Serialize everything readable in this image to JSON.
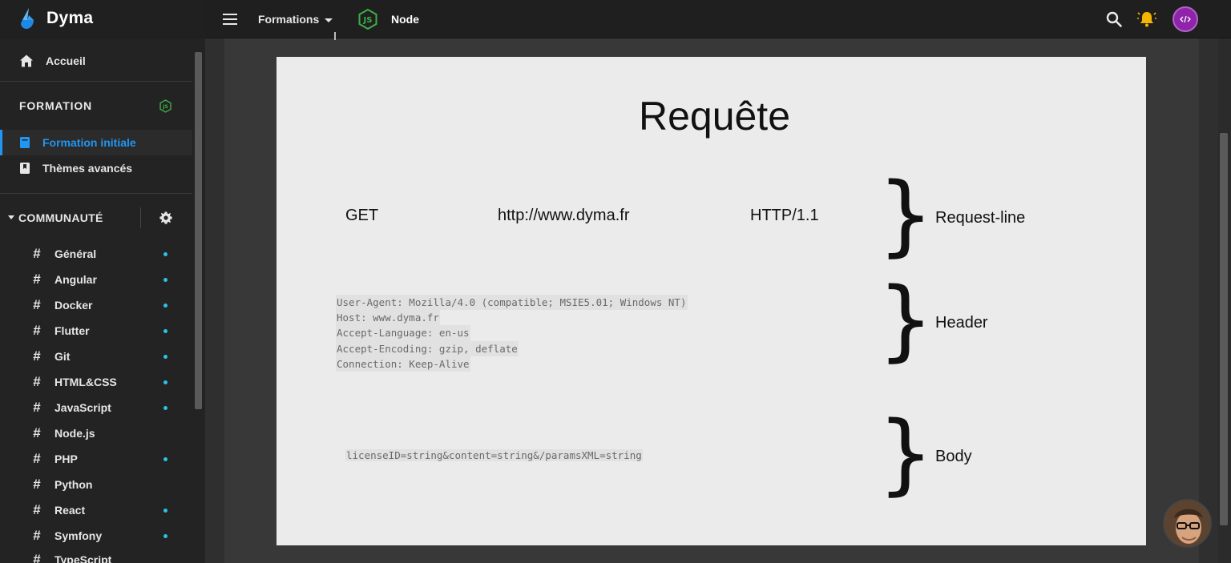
{
  "brand": {
    "name": "Dyma"
  },
  "sidebar": {
    "home_label": "Accueil",
    "section_title": "FORMATION",
    "courses": [
      {
        "label": "Formation initiale",
        "active": true
      },
      {
        "label": "Thèmes avancés",
        "active": false
      }
    ],
    "community_label": "COMMUNAUTÉ",
    "channels": [
      {
        "label": "Général",
        "unread": true
      },
      {
        "label": "Angular",
        "unread": true
      },
      {
        "label": "Docker",
        "unread": true
      },
      {
        "label": "Flutter",
        "unread": true
      },
      {
        "label": "Git",
        "unread": true
      },
      {
        "label": "HTML&CSS",
        "unread": true
      },
      {
        "label": "JavaScript",
        "unread": true
      },
      {
        "label": "Node.js",
        "unread": false
      },
      {
        "label": "PHP",
        "unread": true
      },
      {
        "label": "Python",
        "unread": false
      },
      {
        "label": "React",
        "unread": true
      },
      {
        "label": "Symfony",
        "unread": true
      },
      {
        "label": "TypeScript",
        "unread": false
      }
    ],
    "channel_prefix": "#"
  },
  "topbar": {
    "formations_label": "Formations",
    "course_title": "Node"
  },
  "slide": {
    "title": "Requête",
    "method": "GET",
    "url": "http://www.dyma.fr",
    "version": "HTTP/1.1",
    "labels": [
      "Request-line",
      "Header",
      "Body"
    ],
    "header_lines": [
      "User-Agent: Mozilla/4.0 (compatible; MSIE5.01; Windows NT)",
      "Host: www.dyma.fr",
      "Accept-Language: en-us",
      "Accept-Encoding: gzip, deflate",
      "Connection: Keep-Alive"
    ],
    "body_line": "licenseID=string&content=string&/paramsXML=string"
  },
  "colors": {
    "accent": "#2196f3",
    "unread_dot": "#29c4e8",
    "node_green": "#3fae49",
    "bell": "#f5b400",
    "avatar": "#8e24aa"
  }
}
